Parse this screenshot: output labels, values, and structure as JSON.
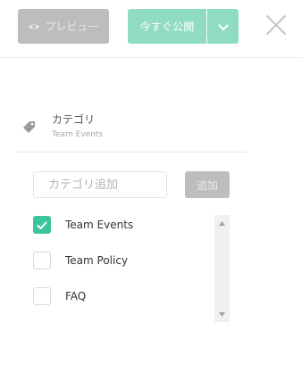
{
  "toolbar": {
    "preview_label": "プレビュー",
    "publish_label": "今すぐ公開",
    "icons": {
      "preview": "eye-icon",
      "publish_menu": "chevron-down-icon",
      "close": "close-icon"
    }
  },
  "category": {
    "title": "カテゴリ",
    "selected": "Team Events",
    "icon": "tag-icon",
    "add_placeholder": "カテゴリ追加",
    "add_button": "追加",
    "items": [
      {
        "label": "Team Events",
        "checked": true
      },
      {
        "label": "Team Policy",
        "checked": false
      },
      {
        "label": "FAQ",
        "checked": false
      }
    ]
  },
  "colors": {
    "accent": "#3cc59a",
    "publish_button": "#8fdcc1",
    "disabled_button": "#bdbdbd"
  }
}
